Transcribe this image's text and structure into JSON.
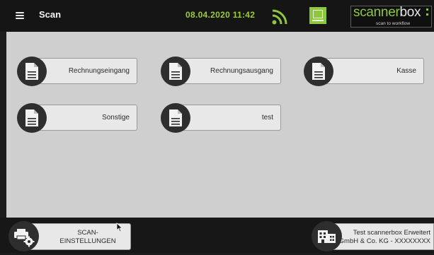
{
  "header": {
    "title": "Scan",
    "datetime": "08.04.2020 11:42",
    "logo_scanner": "scanner",
    "logo_box": "box",
    "logo_tagline": "scan to workflow",
    "wifi_icon": "wifi-signal-icon",
    "status_icon": "device-status-icon",
    "accent_color": "#8dc63f"
  },
  "tiles": [
    {
      "label": "Rechnungseingang",
      "icon": "document-icon"
    },
    {
      "label": "Rechnungsausgang",
      "icon": "document-icon"
    },
    {
      "label": "Kasse",
      "icon": "document-icon"
    },
    {
      "label": "Sonstige",
      "icon": "document-icon"
    },
    {
      "label": "test",
      "icon": "document-icon"
    }
  ],
  "footer": {
    "scan_settings_line1": "SCAN-",
    "scan_settings_line2": "EINSTELLUNGEN",
    "scan_settings_icon": "printer-settings-icon",
    "company_line1": "Test scannerbox Erweitert",
    "company_line2": "GmbH & Co. KG - XXXXXXXX",
    "company_icon": "building-icon"
  }
}
